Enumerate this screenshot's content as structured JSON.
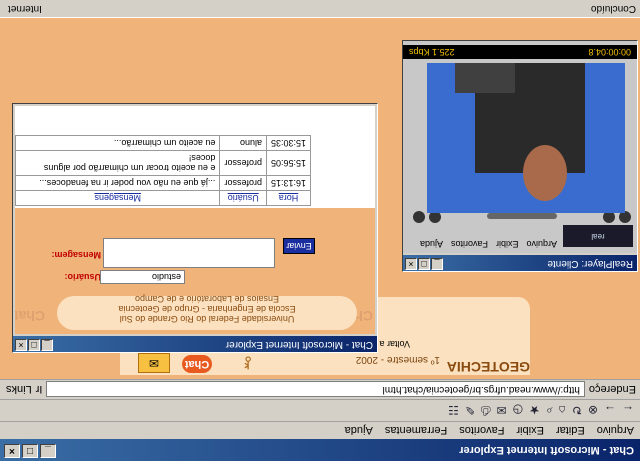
{
  "browser": {
    "title": "Chat - Microsoft Internet Explorer",
    "menu": [
      "Arquivo",
      "Editar",
      "Exibir",
      "Favoritos",
      "Ferramentas",
      "Ajuda"
    ],
    "address_label": "Endereço",
    "address": "http://www.nead.ufrgs.br/geotecnia/chat.html",
    "go_label": "Ir",
    "links_label": "Links",
    "status_left": "Concluído",
    "status_right": "Internet"
  },
  "page": {
    "logo": "GEOTECHIA",
    "semestre": "1º semestre - 2002",
    "chat_label": "Chat",
    "sair": "Voltar a página"
  },
  "chat_window": {
    "title": "Chat - Microsoft Internet Explorer",
    "banner_line1": "Universidade Federal do Rio Grande do Sul",
    "banner_line2": "Escola de Engenharia - Grupo de Geotecnia",
    "banner_line3": "Ensaios de Laboratório e de Campo",
    "side_label": "Chat",
    "usuario_label": "Usuário:",
    "usuario_value": "estudio",
    "mensagem_label": "Mensagem:",
    "enviar_label": "Enviar",
    "columns": [
      "Hora",
      "Usuário",
      "Mensagens"
    ],
    "rows": [
      {
        "hora": "16:13:15",
        "usuario": "professor",
        "msg": "...já que eu não vou poder ir na fenadoces..."
      },
      {
        "hora": "15:56:05",
        "usuario": "professor",
        "msg": "e eu aceito trocar um chimarrão por alguns doces!"
      },
      {
        "hora": "15:30:35",
        "usuario": "aluno",
        "msg": "eu aceito um chimarrão..."
      }
    ]
  },
  "player": {
    "title": "RealPlayer: Cliente",
    "menu": [
      "Arquivo",
      "Exibir",
      "Favoritos",
      "Ajuda"
    ],
    "logo": "real",
    "bitrate": "225.1 Kbps",
    "time": "00:00:04.8"
  }
}
